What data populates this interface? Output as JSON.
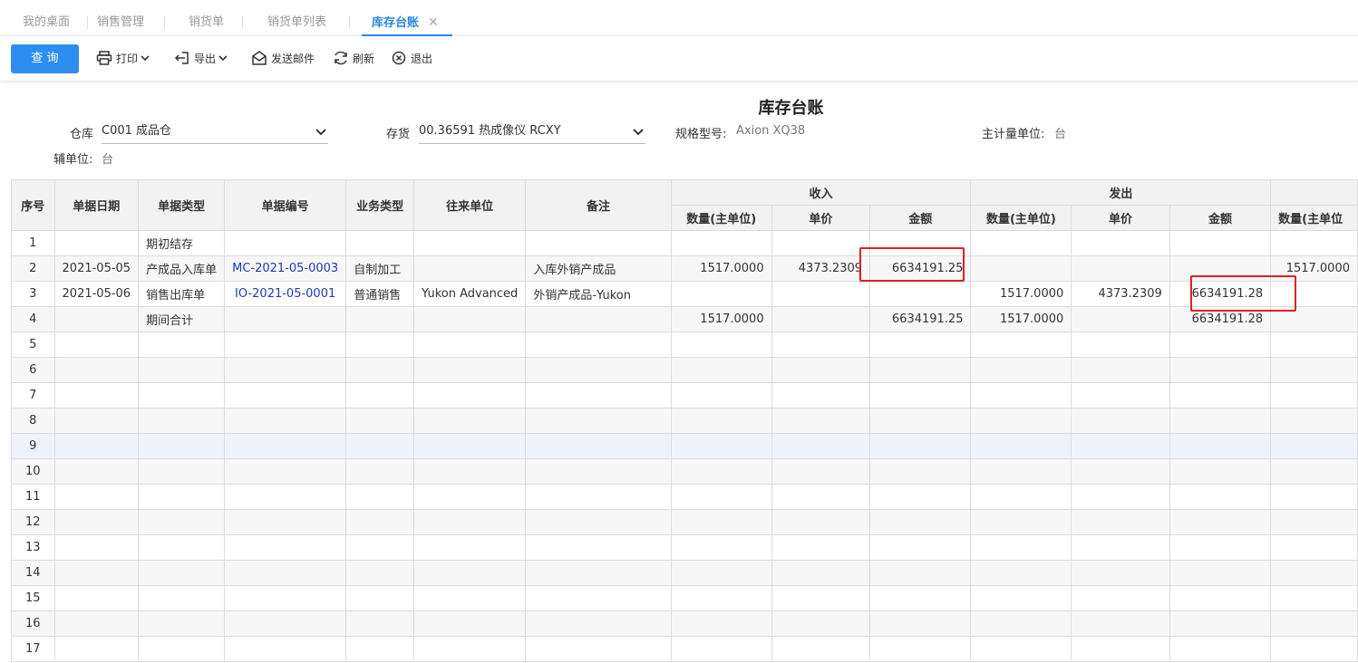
{
  "tabs": [
    {
      "label": "我的桌面"
    },
    {
      "label": "销售管理"
    },
    {
      "label": "销货单"
    },
    {
      "label": "销货单列表"
    },
    {
      "label": "库存台账",
      "active": true,
      "close": "✕"
    }
  ],
  "toolbar": {
    "query": "查 询",
    "print": "打印",
    "export": "导出",
    "email": "发送邮件",
    "refresh": "刷新",
    "exit": "退出"
  },
  "title": "库存台账",
  "filters": {
    "warehouse_label": "仓库",
    "warehouse_value": "C001 成品仓",
    "item_label": "存货",
    "item_value": "00.36591 热成像仪 RCXY",
    "spec_label": "规格型号:",
    "spec_value": "Axion XQ38",
    "main_unit_label": "主计量单位:",
    "main_unit_value": "台",
    "aux_unit_label": "辅单位:",
    "aux_unit_value": "台"
  },
  "grid": {
    "headers": {
      "seq": "序号",
      "date": "单据日期",
      "type": "单据类型",
      "code": "单据编号",
      "biz": "业务类型",
      "partner": "往来单位",
      "remark": "备注",
      "income": "收入",
      "outgo": "发出",
      "qty": "数量(主单位)",
      "price": "单价",
      "amount": "金额",
      "qty_cut": "数量(主单位"
    },
    "rows": [
      {
        "seq": "1",
        "date": "",
        "type": "期初结存",
        "code": "",
        "biz": "",
        "partner": "",
        "remark": "",
        "in_qty": "",
        "in_price": "",
        "in_amt": "",
        "out_qty": "",
        "out_price": "",
        "out_amt": "",
        "bal_qty": ""
      },
      {
        "seq": "2",
        "date": "2021-05-05",
        "type": "产成品入库单",
        "code": "MC-2021-05-0003",
        "biz": "自制加工",
        "partner": "",
        "remark": "入库外销产成品",
        "in_qty": "1517.0000",
        "in_price": "4373.2309",
        "in_amt": "6634191.25",
        "out_qty": "",
        "out_price": "",
        "out_amt": "",
        "bal_qty": "1517.0000"
      },
      {
        "seq": "3",
        "date": "2021-05-06",
        "type": "销售出库单",
        "code": "IO-2021-05-0001",
        "biz": "普通销售",
        "partner": "Yukon Advanced",
        "remark": "外销产成品-Yukon",
        "in_qty": "",
        "in_price": "",
        "in_amt": "",
        "out_qty": "1517.0000",
        "out_price": "4373.2309",
        "out_amt": "6634191.28",
        "bal_qty": ""
      },
      {
        "seq": "4",
        "date": "",
        "type": "期间合计",
        "code": "",
        "biz": "",
        "partner": "",
        "remark": "",
        "in_qty": "1517.0000",
        "in_price": "",
        "in_amt": "6634191.25",
        "out_qty": "1517.0000",
        "out_price": "",
        "out_amt": "6634191.28",
        "bal_qty": ""
      },
      {
        "seq": "5"
      },
      {
        "seq": "6"
      },
      {
        "seq": "7"
      },
      {
        "seq": "8"
      },
      {
        "seq": "9"
      },
      {
        "seq": "10"
      },
      {
        "seq": "11"
      },
      {
        "seq": "12"
      },
      {
        "seq": "13"
      },
      {
        "seq": "14"
      },
      {
        "seq": "15"
      },
      {
        "seq": "16"
      },
      {
        "seq": "17"
      }
    ]
  },
  "colors": {
    "accent": "#2e8ef0",
    "highlight": "#e02020",
    "link": "#1a3bb5"
  }
}
